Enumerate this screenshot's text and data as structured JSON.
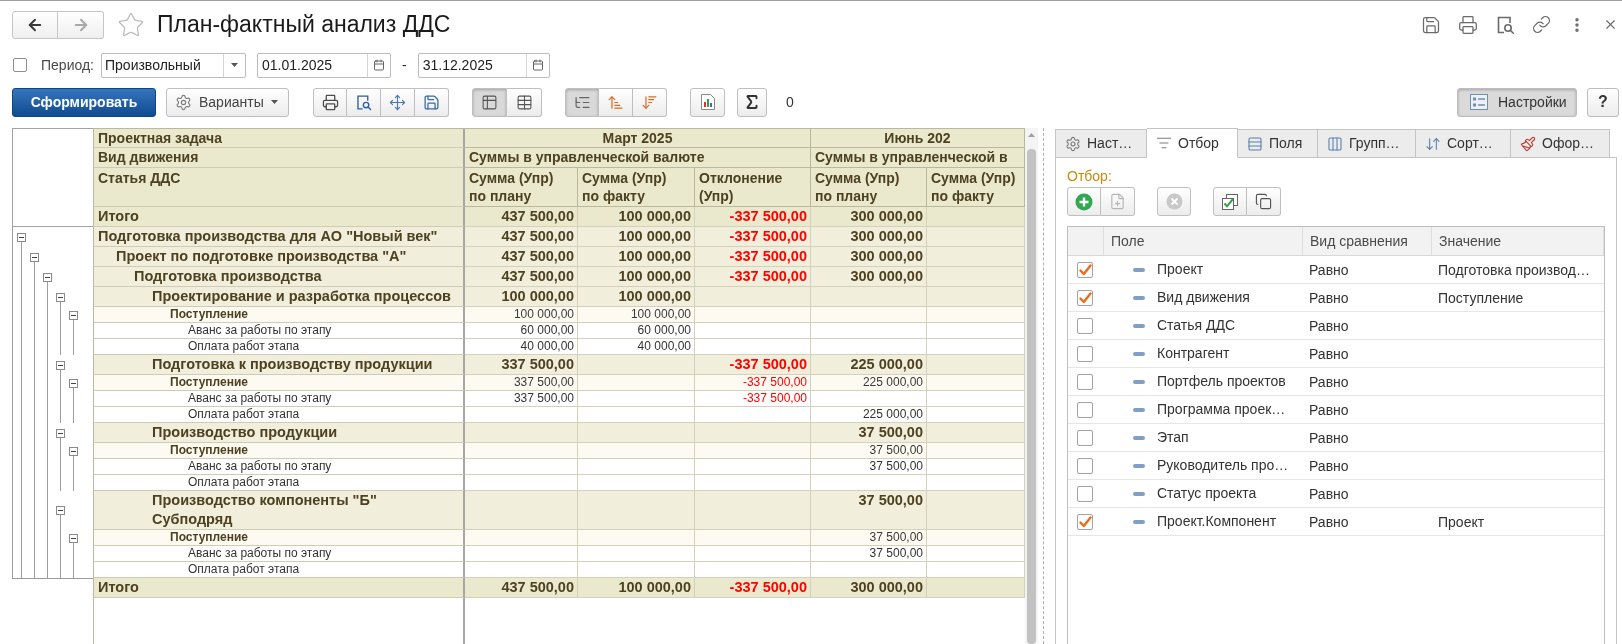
{
  "window": {
    "title": "План-фактный анализ ДДС",
    "favorite": false,
    "navigation": [
      {
        "kind": "back",
        "disabled": false
      },
      {
        "kind": "forward",
        "disabled": true
      }
    ]
  },
  "period": {
    "checked": false,
    "label": "Период:",
    "type": "Произвольный",
    "start": "01.01.2025",
    "separator": "-",
    "end": "31.12.2025"
  },
  "toolbar": {
    "generate_button": "Сформировать",
    "variants_button": "Варианты",
    "view_toggles": [
      {
        "selected": true
      },
      {
        "selected": false
      }
    ],
    "order_toggles": [
      {
        "selected": true
      },
      {
        "selected": false
      },
      {
        "selected": false
      }
    ],
    "sum_count": "0",
    "settings_button": {
      "label": "Настройки",
      "selected": true
    },
    "help_button": "?"
  },
  "report": {
    "row_headers": [
      "Проектная задача",
      "Вид движения",
      "Статья ДДС"
    ],
    "periods": [
      {
        "label": "Март 2025",
        "group": "Суммы в управленческой валюте",
        "columns": [
          {
            "label": "Сумма (Упр)\nпо плану",
            "kind": "amount"
          },
          {
            "label": "Сумма (Упр)\nпо факту",
            "kind": "amount"
          },
          {
            "label": "Отклонение\n(Упр)",
            "kind": "deviation"
          }
        ]
      },
      {
        "label": "Июнь 202",
        "group": "Суммы в управленческой в",
        "columns": [
          {
            "label": "Сумма (Упр)\nпо плану",
            "kind": "amount"
          },
          {
            "label": "Сумма (Упр)\nпо факту",
            "kind": "amount"
          }
        ]
      }
    ],
    "total_top": {
      "label": "Итого",
      "values": {
        "column_1": "437 500,00",
        "column_2": "100 000,00",
        "column_3": "-337 500,00",
        "column_4": "300 000,00"
      }
    },
    "rows": [
      {
        "kind": "group",
        "label": "Подготовка производства для АО \"Новый век\"",
        "expanded": true,
        "values": {
          "column_1": "437 500,00",
          "column_2": "100 000,00",
          "column_3": "-337 500,00",
          "column_4": "300 000,00"
        },
        "children": [
          {
            "kind": "group",
            "label": "Проект по подготовке производства \"А\"",
            "expanded": true,
            "values": {
              "column_1": "437 500,00",
              "column_2": "100 000,00",
              "column_3": "-337 500,00",
              "column_4": "300 000,00"
            },
            "children": [
              {
                "kind": "group",
                "label": "Подготовка производства",
                "expanded": true,
                "values": {
                  "column_1": "437 500,00",
                  "column_2": "100 000,00",
                  "column_3": "-337 500,00",
                  "column_4": "300 000,00"
                },
                "children": [
                  {
                    "kind": "group",
                    "label": "Проектирование и разработка процессов",
                    "expanded": true,
                    "values": {
                      "column_1": "100 000,00",
                      "column_2": "100 000,00"
                    },
                    "children": [
                      {
                        "kind": "movement",
                        "label": "Поступление",
                        "expanded": true,
                        "values": {
                          "column_1": "100 000,00",
                          "column_2": "100 000,00"
                        },
                        "children": [
                          {
                            "kind": "article",
                            "label": "Аванс за работы по этапу",
                            "values": {
                              "column_1": "60 000,00",
                              "column_2": "60 000,00"
                            }
                          },
                          {
                            "kind": "article",
                            "label": "Оплата работ этапа",
                            "values": {
                              "column_1": "40 000,00",
                              "column_2": "40 000,00"
                            }
                          }
                        ]
                      }
                    ]
                  },
                  {
                    "kind": "group",
                    "label": "Подготовка к производству продукции",
                    "expanded": true,
                    "values": {
                      "column_1": "337 500,00",
                      "column_3": "-337 500,00",
                      "column_4": "225 000,00"
                    },
                    "children": [
                      {
                        "kind": "movement",
                        "label": "Поступление",
                        "expanded": true,
                        "values": {
                          "column_1": "337 500,00",
                          "column_3": "-337 500,00",
                          "column_4": "225 000,00"
                        },
                        "children": [
                          {
                            "kind": "article",
                            "label": "Аванс за работы по этапу",
                            "values": {
                              "column_1": "337 500,00",
                              "column_3": "-337 500,00"
                            }
                          },
                          {
                            "kind": "article",
                            "label": "Оплата работ этапа",
                            "values": {
                              "column_4": "225 000,00"
                            }
                          }
                        ]
                      }
                    ]
                  },
                  {
                    "kind": "group",
                    "label": "Производство продукции",
                    "expanded": true,
                    "values": {
                      "column_4": "37 500,00"
                    },
                    "children": [
                      {
                        "kind": "movement",
                        "label": "Поступление",
                        "expanded": true,
                        "values": {
                          "column_4": "37 500,00"
                        },
                        "children": [
                          {
                            "kind": "article",
                            "label": "Аванс за работы по этапу",
                            "values": {
                              "column_4": "37 500,00"
                            }
                          },
                          {
                            "kind": "article",
                            "label": "Оплата работ этапа"
                          }
                        ]
                      }
                    ]
                  },
                  {
                    "kind": "group",
                    "label": "Производство компоненты \"Б\"\nСубподряд",
                    "expanded": true,
                    "values": {
                      "column_4": "37 500,00"
                    },
                    "children": [
                      {
                        "kind": "movement",
                        "label": "Поступление",
                        "expanded": true,
                        "values": {
                          "column_4": "37 500,00"
                        },
                        "children": [
                          {
                            "kind": "article",
                            "label": "Аванс за работы по этапу",
                            "values": {
                              "column_4": "37 500,00"
                            }
                          },
                          {
                            "kind": "article",
                            "label": "Оплата работ этапа"
                          }
                        ]
                      }
                    ]
                  }
                ]
              }
            ]
          }
        ]
      }
    ],
    "total_bottom": {
      "label": "Итого",
      "values": {
        "column_1": "437 500,00",
        "column_2": "100 000,00",
        "column_3": "-337 500,00",
        "column_4": "300 000,00"
      }
    }
  },
  "settings_panel": {
    "tabs": [
      {
        "label": "Наст…",
        "selected": false
      },
      {
        "label": "Отбор",
        "selected": true
      },
      {
        "label": "Поля",
        "selected": false
      },
      {
        "label": "Групп…",
        "selected": false
      },
      {
        "label": "Сорт…",
        "selected": false
      },
      {
        "label": "Офор…",
        "selected": false
      }
    ],
    "filter": {
      "title": "Отбор:",
      "buttons": [
        {
          "disabled": false
        },
        {
          "disabled": true
        },
        {
          "disabled": true
        },
        {
          "disabled": false
        },
        {
          "disabled": false
        }
      ],
      "columns": [
        "Поле",
        "Вид сравнения",
        "Значение"
      ],
      "rows": [
        {
          "checked": true,
          "field": "Проект",
          "comparison": "Равно",
          "value": "Подготовка производ…"
        },
        {
          "checked": true,
          "field": "Вид движения",
          "comparison": "Равно",
          "value": "Поступление"
        },
        {
          "checked": false,
          "field": "Статья ДДС",
          "comparison": "Равно"
        },
        {
          "checked": false,
          "field": "Контрагент",
          "comparison": "Равно"
        },
        {
          "checked": false,
          "field": "Портфель проектов",
          "comparison": "Равно"
        },
        {
          "checked": false,
          "field": "Программа проек…",
          "comparison": "Равно"
        },
        {
          "checked": false,
          "field": "Этап",
          "comparison": "Равно"
        },
        {
          "checked": false,
          "field": "Руководитель про…",
          "comparison": "Равно"
        },
        {
          "checked": false,
          "field": "Статус проекта",
          "comparison": "Равно"
        },
        {
          "checked": true,
          "field": "Проект.Компонент",
          "comparison": "Равно",
          "value": "Проект"
        }
      ]
    }
  }
}
